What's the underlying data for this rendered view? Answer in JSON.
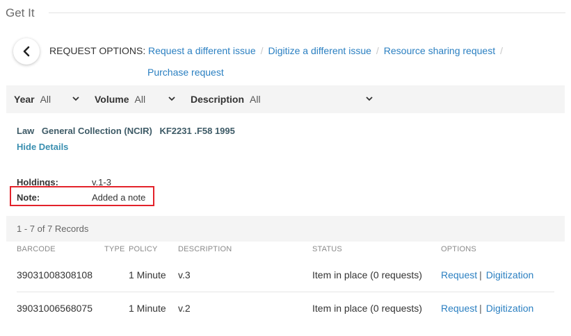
{
  "section_title": "Get It",
  "request_options": {
    "label": "REQUEST OPTIONS:",
    "links": [
      "Request a different issue",
      "Digitize a different issue",
      "Resource sharing request",
      "Purchase request"
    ]
  },
  "filters": {
    "year": {
      "label": "Year",
      "value": "All"
    },
    "volume": {
      "label": "Volume",
      "value": "All"
    },
    "description": {
      "label": "Description",
      "value": "All"
    }
  },
  "location": {
    "library": "Law",
    "collection": "General Collection (NCIR)",
    "call_number": "KF2231 .F58 1995",
    "hide_details": "Hide Details"
  },
  "holdings": {
    "holdings_label": "Holdings:",
    "holdings_value": "v.1-3",
    "note_label": "Note:",
    "note_value": "Added a note"
  },
  "records_summary": "1 - 7 of 7 Records",
  "table": {
    "headers": {
      "barcode": "BARCODE",
      "type": "TYPE",
      "policy": "POLICY",
      "description": "DESCRIPTION",
      "status": "STATUS",
      "options": "OPTIONS"
    },
    "rows": [
      {
        "barcode": "39031008308108",
        "type": "",
        "policy": "1 Minute",
        "description": "v.3",
        "status": "Item in place (0 requests)",
        "request": "Request",
        "digitization": "Digitization"
      },
      {
        "barcode": "39031006568075",
        "type": "",
        "policy": "1 Minute",
        "description": "v.2",
        "status": "Item in place (0 requests)",
        "request": "Request",
        "digitization": "Digitization"
      }
    ]
  },
  "colors": {
    "link": "#2a7fc1",
    "location_text": "#3d5a66",
    "highlight_border": "#e3222a",
    "panel_bg": "#f4f4f4"
  }
}
